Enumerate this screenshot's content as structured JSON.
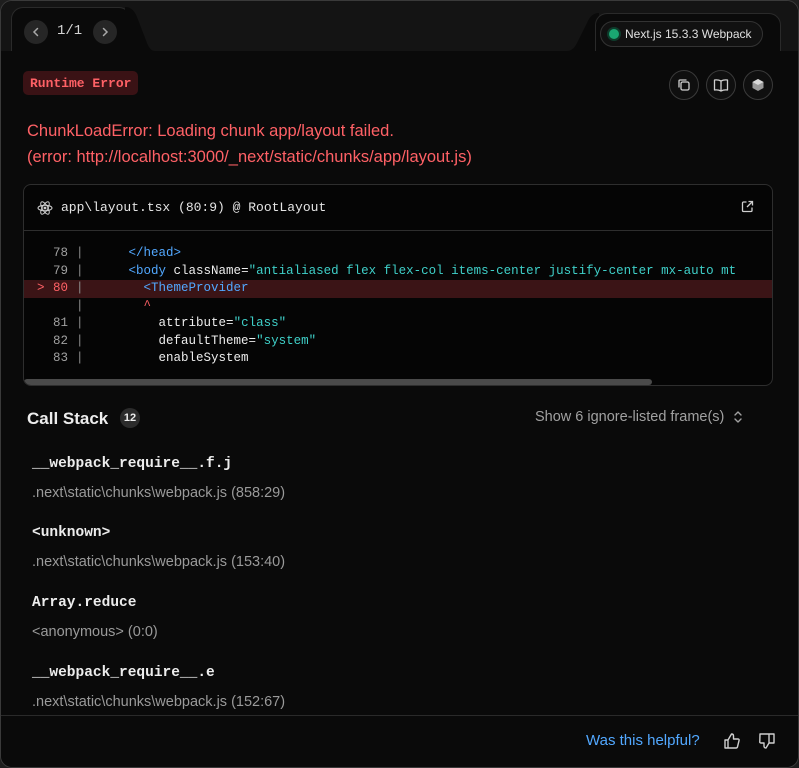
{
  "nav": {
    "prev_icon": "chevron-left-icon",
    "next_icon": "chevron-right-icon",
    "pager": "1/1"
  },
  "version": {
    "label": "Next.js 15.3.3 Webpack",
    "status_color": "#1aa672"
  },
  "error": {
    "type_label": "Runtime Error",
    "message_line1": "ChunkLoadError: Loading chunk app/layout failed.",
    "message_line2": "(error: http://localhost:3000/_next/static/chunks/app/layout.js)",
    "color": "#ff6166"
  },
  "actions": {
    "copy_icon": "copy-icon",
    "docs_icon": "book-icon",
    "nextjs_icon": "hexagon-icon"
  },
  "code_frame": {
    "file": "app\\layout.tsx (80:9) @ RootLayout",
    "lines": [
      {
        "marker": "",
        "num": "78",
        "sep": "|",
        "indent": "      ",
        "parts": [
          {
            "t": "tag",
            "v": "</head>"
          }
        ]
      },
      {
        "marker": "",
        "num": "79",
        "sep": "|",
        "indent": "      ",
        "parts": [
          {
            "t": "tag",
            "v": "<body "
          },
          {
            "t": "attr",
            "v": "className"
          },
          {
            "t": "attr",
            "v": "="
          },
          {
            "t": "str",
            "v": "\"antialiased flex flex-col items-center justify-center mx-auto mt"
          }
        ]
      },
      {
        "marker": ">",
        "num": "80",
        "sep": "|",
        "indent": "        ",
        "parts": [
          {
            "t": "tag",
            "v": "<ThemeProvider"
          }
        ]
      },
      {
        "marker": "",
        "num": "",
        "sep": "|",
        "indent": "        ",
        "parts": [
          {
            "t": "caret",
            "v": "^"
          }
        ]
      },
      {
        "marker": "",
        "num": "81",
        "sep": "|",
        "indent": "          ",
        "parts": [
          {
            "t": "attr",
            "v": "attribute"
          },
          {
            "t": "attr",
            "v": "="
          },
          {
            "t": "str",
            "v": "\"class\""
          }
        ]
      },
      {
        "marker": "",
        "num": "82",
        "sep": "|",
        "indent": "          ",
        "parts": [
          {
            "t": "attr",
            "v": "defaultTheme"
          },
          {
            "t": "attr",
            "v": "="
          },
          {
            "t": "str",
            "v": "\"system\""
          }
        ]
      },
      {
        "marker": "",
        "num": "83",
        "sep": "|",
        "indent": "          ",
        "parts": [
          {
            "t": "attr",
            "v": "enableSystem"
          }
        ]
      }
    ]
  },
  "call_stack": {
    "title": "Call Stack",
    "count": "12",
    "toggle_label": "Show 6 ignore-listed frame(s)",
    "frames": [
      {
        "fn": "__webpack_require__.f.j",
        "loc": ".next\\static\\chunks\\webpack.js (858:29)"
      },
      {
        "fn": "<unknown>",
        "loc": ".next\\static\\chunks\\webpack.js (153:40)"
      },
      {
        "fn": "Array.reduce",
        "loc": "<anonymous> (0:0)"
      },
      {
        "fn": "__webpack_require__.e",
        "loc": ".next\\static\\chunks\\webpack.js (152:67)"
      }
    ]
  },
  "footer": {
    "helpful_label": "Was this helpful?",
    "thumbs_up_icon": "thumbs-up-icon",
    "thumbs_down_icon": "thumbs-down-icon"
  }
}
